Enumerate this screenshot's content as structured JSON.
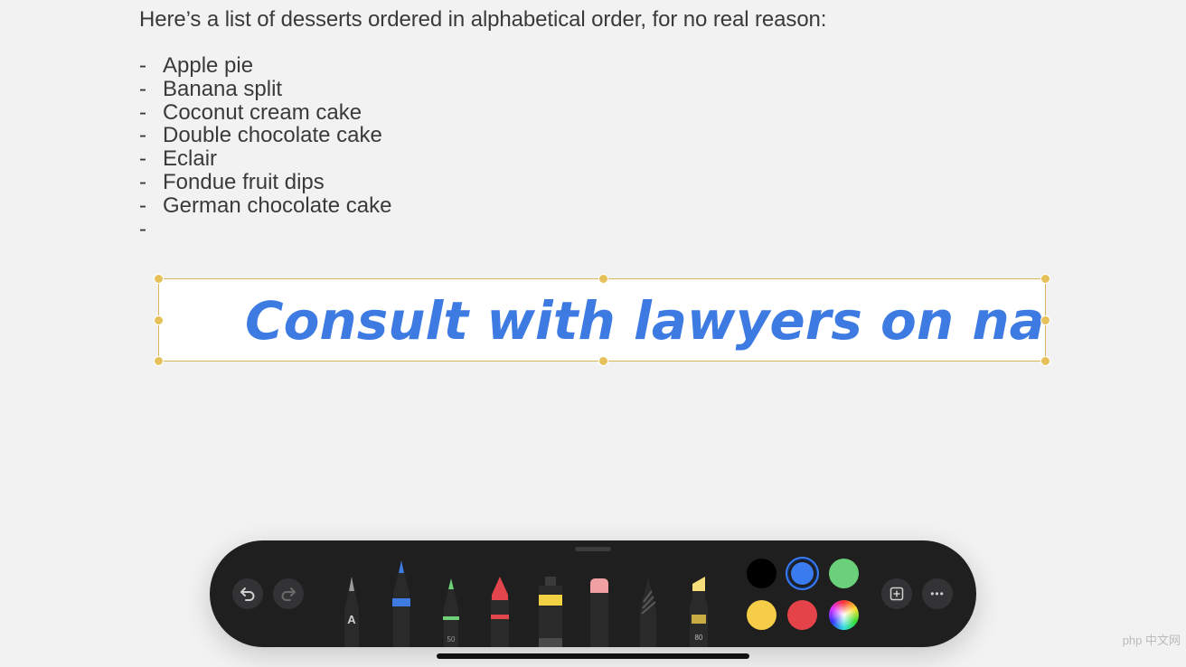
{
  "note": {
    "intro": "Here’s a list of desserts ordered in alphabetical order, for no real reason:",
    "list_marker": "-",
    "items": [
      "Apple pie",
      "Banana split",
      "Coconut cream cake",
      "Double chocolate cake",
      "Eclair",
      "Fondue fruit dips",
      "German chocolate cake",
      ""
    ]
  },
  "drawing": {
    "handwriting": "Consult with lawyers on names!",
    "ink_color": "#3d7be3",
    "selection_color": "#e6c15a"
  },
  "toolbar": {
    "undo_icon": "undo-icon",
    "redo_icon": "redo-icon",
    "tools": [
      {
        "name": "monoline-pen",
        "label": "A",
        "tip_color": "#9a9a9a"
      },
      {
        "name": "pen",
        "label": "",
        "tip_color": "#3d7be3"
      },
      {
        "name": "marker",
        "label": "50",
        "tip_color": "#6fd07a"
      },
      {
        "name": "crayon",
        "label": "",
        "tip_color": "#e2454b"
      },
      {
        "name": "watercolor",
        "label": "",
        "tip_color": "#f2d142"
      },
      {
        "name": "eraser",
        "label": "",
        "tip_color": "#f0a0a3"
      },
      {
        "name": "lasso",
        "label": "",
        "tip_color": "#666"
      },
      {
        "name": "highlighter",
        "label": "80",
        "tip_color": "#f6df7a"
      }
    ],
    "colors": [
      {
        "name": "black",
        "hex": "#000000",
        "selected": false
      },
      {
        "name": "blue",
        "hex": "#3a7bf0",
        "selected": true
      },
      {
        "name": "green",
        "hex": "#6bd07a"
      },
      {
        "name": "yellow",
        "hex": "#f6cd46"
      },
      {
        "name": "red",
        "hex": "#e5434a"
      },
      {
        "name": "color-picker",
        "hex": "multicolor"
      }
    ],
    "add_icon": "plus-square-icon",
    "more_icon": "ellipsis-icon",
    "more_label": "•••"
  },
  "watermark": "php 中文网"
}
